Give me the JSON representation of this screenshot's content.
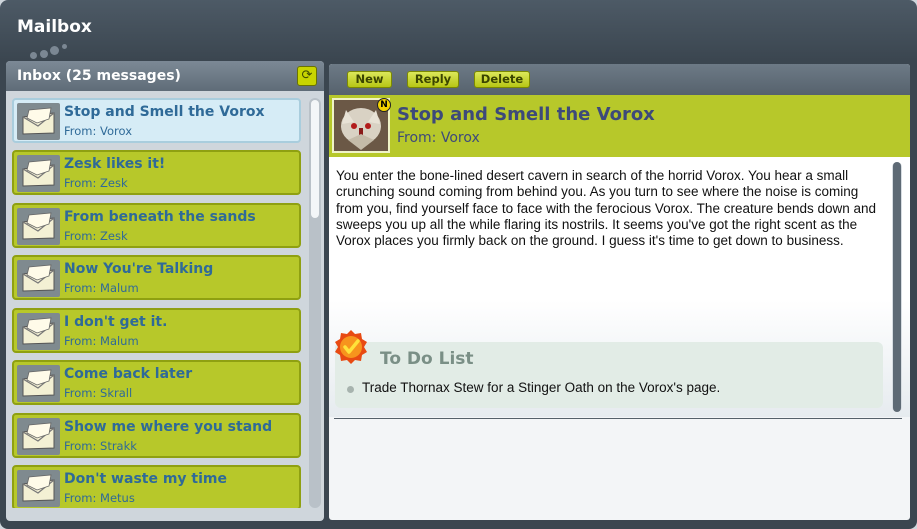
{
  "window": {
    "title": "Mailbox"
  },
  "inbox": {
    "title": "Inbox (25 messages)",
    "messages": [
      {
        "subject": "Stop and Smell the Vorox",
        "from": "From: Vorox",
        "selected": true
      },
      {
        "subject": "Zesk likes it!",
        "from": "From: Zesk"
      },
      {
        "subject": "From beneath the sands",
        "from": "From: Zesk"
      },
      {
        "subject": "Now You're Talking",
        "from": "From: Malum"
      },
      {
        "subject": "I don't get it.",
        "from": "From: Malum"
      },
      {
        "subject": "Come back later",
        "from": "From: Skrall"
      },
      {
        "subject": "Show me where you stand",
        "from": "From: Strakk"
      },
      {
        "subject": "Don't waste my time",
        "from": "From: Metus"
      }
    ]
  },
  "toolbar": {
    "new_label": "New",
    "reply_label": "Reply",
    "delete_label": "Delete"
  },
  "message": {
    "subject": "Stop and Smell the Vorox",
    "from": "From: Vorox",
    "badge": "N",
    "body": "You enter the bone-lined desert cavern in search of the horrid Vorox. You hear a small crunching sound coming from behind you. As you turn to see where the noise is coming from you, find yourself face to face with the ferocious Vorox. The creature bends down and sweeps you up all the while flaring its nostrils. It seems you've got the right scent as the Vorox places you firmly back on the ground. I guess it's time to get down to business.",
    "todo": {
      "title": "To Do List",
      "items": [
        "Trade Thornax Stew for a Stinger Oath on the Vorox's page."
      ]
    }
  },
  "colors": {
    "accent": "#b7c82a",
    "selected": "#d6ecf6",
    "frame": "#3b4650",
    "link": "#2f6a98"
  },
  "icons": {
    "message": "envelope-icon",
    "refresh": "refresh-icon",
    "todo": "checkmark-badge-icon"
  }
}
